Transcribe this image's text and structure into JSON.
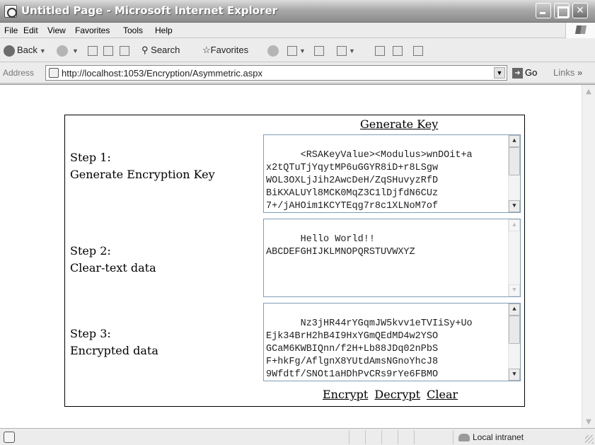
{
  "window": {
    "title": "Untitled Page - Microsoft Internet Explorer"
  },
  "menu": {
    "file": "File",
    "edit": "Edit",
    "view": "View",
    "favorites": "Favorites",
    "tools": "Tools",
    "help": "Help"
  },
  "toolbar": {
    "back": "Back",
    "search": "Search",
    "favorites": "Favorites"
  },
  "address": {
    "label": "Address",
    "url": "http://localhost:1053/Encryption/Asymmetric.aspx",
    "go": "Go",
    "links": "Links"
  },
  "page": {
    "generate_key": "Generate Key",
    "step1_title": "Step 1:",
    "step1_desc": "Generate Encryption Key",
    "step2_title": "Step 2:",
    "step2_desc": "Clear-text data",
    "step3_title": "Step 3:",
    "step3_desc": "Encrypted data",
    "key_text": "<RSAKeyValue><Modulus>wnDOit+a\nx2tQTuTjYqytMP6uGGYR8iD+r8LSgw\nWOL3OXLjJih2AwcDeH/ZqSHuvyzRfD\nBiKXALUYl8MCK0MqZ3C1lDjfdN6CUz\n7+/jAHOim1KCYTEqg7r8c1XLNoM7of",
    "clear_text": "Hello World!!\nABCDEFGHIJKLMNOPQRSTUVWXYZ",
    "encrypted_text": "Nz3jHR44rYGqmJW5kvv1eTVIiSy+Uo\nEjk34BrH2hB4I9HxYGmQEdMD4w2YSO\nGCaM6KWBIQnn/f2H+Lb88JDq02nPbS\nF+hkFg/AflgnX8YUtdAmsNGnoYhcJ8\n9Wfdtf/SNOt1aHDhPvCRs9rYe6FBMO",
    "encrypt": "Encrypt",
    "decrypt": "Decrypt",
    "clear": "Clear"
  },
  "status": {
    "zone": "Local intranet"
  }
}
